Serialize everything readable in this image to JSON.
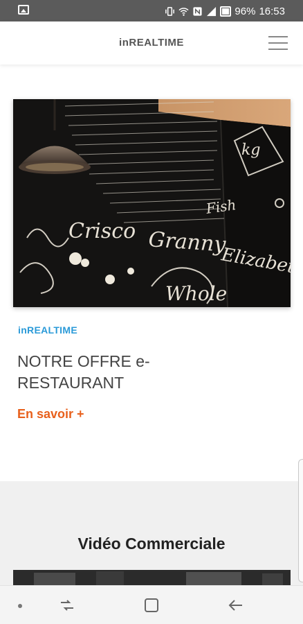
{
  "status_bar": {
    "battery": "96%",
    "time": "16:53",
    "icons": [
      "image-icon",
      "vibrate-icon",
      "wifi-icon",
      "nfc-icon",
      "signal-icon",
      "battery-icon"
    ]
  },
  "header": {
    "title": "inREALTIME",
    "menu_icon": "hamburger-menu-icon"
  },
  "article": {
    "image": {
      "words": [
        "Crisco",
        "Granny",
        "Elizabeth",
        "Whole",
        "kg",
        "Fish"
      ]
    },
    "category": "inREALTIME",
    "headline": "NOTRE OFFRE e-RESTAURANT",
    "read_more": "En savoir +"
  },
  "video_section": {
    "title": "Vidéo Commerciale"
  },
  "nav_bar": {
    "icons": [
      "dot-icon",
      "recent-apps-icon",
      "home-icon",
      "back-icon"
    ]
  },
  "colors": {
    "accent_blue": "#2a9ad8",
    "accent_orange": "#e8601c",
    "status_bar": "#5b5b5b"
  }
}
